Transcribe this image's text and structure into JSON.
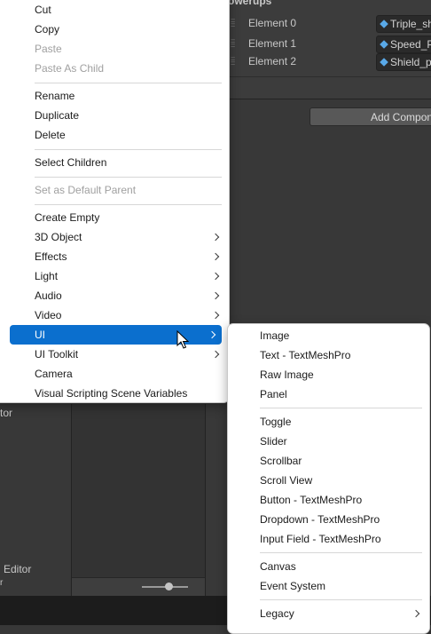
{
  "inspector": {
    "header": "owerups",
    "elements": [
      {
        "label": "Element 0",
        "value": "Triple_sh"
      },
      {
        "label": "Element 1",
        "value": "Speed_P"
      },
      {
        "label": "Element 2",
        "value": "Shield_p"
      }
    ],
    "add_component": "Add Compon"
  },
  "background_texts": {
    "left_top": "tor",
    "left_bottom": "Editor",
    "left_bottom_sub": "r"
  },
  "context_menu": {
    "items": [
      {
        "label": "Cut",
        "disabled": false,
        "submenu": false
      },
      {
        "label": "Copy",
        "disabled": false,
        "submenu": false
      },
      {
        "label": "Paste",
        "disabled": true,
        "submenu": false
      },
      {
        "label": "Paste As Child",
        "disabled": true,
        "submenu": false
      },
      {
        "label": "Rename",
        "disabled": false,
        "submenu": false
      },
      {
        "label": "Duplicate",
        "disabled": false,
        "submenu": false
      },
      {
        "label": "Delete",
        "disabled": false,
        "submenu": false
      },
      {
        "label": "Select Children",
        "disabled": false,
        "submenu": false
      },
      {
        "label": "Set as Default Parent",
        "disabled": true,
        "submenu": false
      },
      {
        "label": "Create Empty",
        "disabled": false,
        "submenu": false
      },
      {
        "label": "3D Object",
        "disabled": false,
        "submenu": true
      },
      {
        "label": "Effects",
        "disabled": false,
        "submenu": true
      },
      {
        "label": "Light",
        "disabled": false,
        "submenu": true
      },
      {
        "label": "Audio",
        "disabled": false,
        "submenu": true
      },
      {
        "label": "Video",
        "disabled": false,
        "submenu": true
      },
      {
        "label": "UI",
        "disabled": false,
        "submenu": true,
        "highlighted": true
      },
      {
        "label": "UI Toolkit",
        "disabled": false,
        "submenu": true
      },
      {
        "label": "Camera",
        "disabled": false,
        "submenu": false
      },
      {
        "label": "Visual Scripting Scene Variables",
        "disabled": false,
        "submenu": false
      }
    ]
  },
  "ui_submenu": {
    "items": [
      {
        "label": "Image",
        "submenu": false
      },
      {
        "label": "Text - TextMeshPro",
        "submenu": false
      },
      {
        "label": "Raw Image",
        "submenu": false
      },
      {
        "label": "Panel",
        "submenu": false
      },
      {
        "label": "Toggle",
        "submenu": false
      },
      {
        "label": "Slider",
        "submenu": false
      },
      {
        "label": "Scrollbar",
        "submenu": false
      },
      {
        "label": "Scroll View",
        "submenu": false
      },
      {
        "label": "Button - TextMeshPro",
        "submenu": false
      },
      {
        "label": "Dropdown - TextMeshPro",
        "submenu": false
      },
      {
        "label": "Input Field - TextMeshPro",
        "submenu": false
      },
      {
        "label": "Canvas",
        "submenu": false
      },
      {
        "label": "Event System",
        "submenu": false
      },
      {
        "label": "Legacy",
        "submenu": true
      }
    ]
  },
  "colors": {
    "highlight": "#0b6fce",
    "menu_bg": "#ffffff",
    "disabled_text": "#a0a0a0",
    "editor_bg": "#383838",
    "prefab_icon": "#59a9e8"
  },
  "icons": {
    "submenu_arrow": "chevron-right-icon",
    "prefab": "prefab-cube-icon",
    "cursor": "mouse-pointer-icon",
    "drag_handle": "drag-handle-icon"
  }
}
